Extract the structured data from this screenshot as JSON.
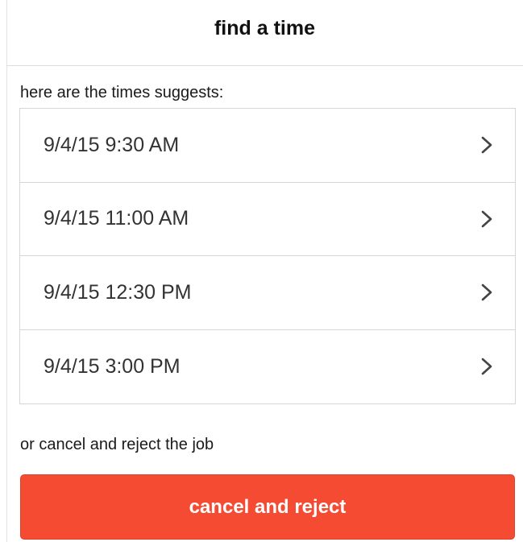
{
  "header": {
    "title": "find a time"
  },
  "suggestions": {
    "intro": "here are the times suggests:",
    "items": [
      {
        "label": "9/4/15 9:30 AM",
        "icon": "chevron-right-icon"
      },
      {
        "label": "9/4/15 11:00 AM",
        "icon": "chevron-right-icon"
      },
      {
        "label": "9/4/15 12:30 PM",
        "icon": "chevron-right-icon"
      },
      {
        "label": "9/4/15 3:00 PM",
        "icon": "chevron-right-icon"
      }
    ]
  },
  "cancel": {
    "prompt": "or cancel and reject the job",
    "button_label": "cancel and reject",
    "button_color": "#f54b33"
  }
}
